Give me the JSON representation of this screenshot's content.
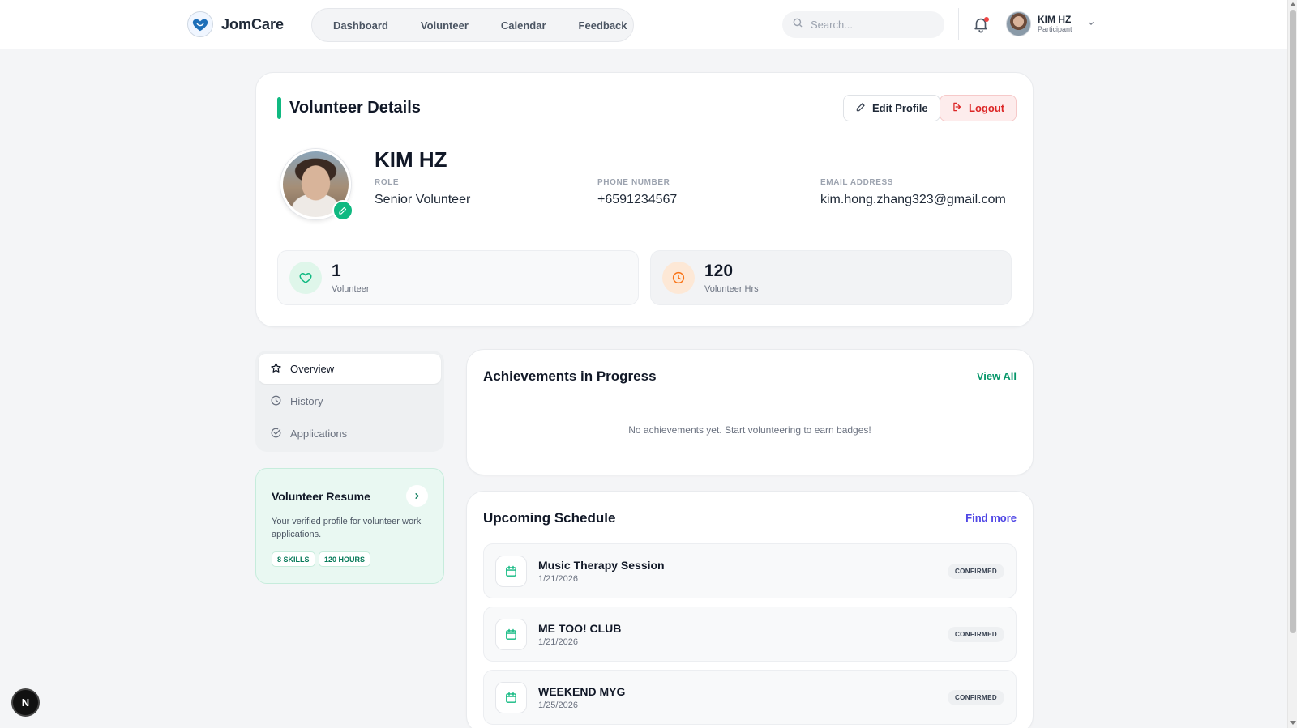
{
  "brand": {
    "name": "JomCare"
  },
  "nav": {
    "items": [
      "Dashboard",
      "Volunteer",
      "Calendar",
      "Feedback"
    ]
  },
  "search": {
    "placeholder": "Search..."
  },
  "user": {
    "name": "KIM HZ",
    "role": "Participant"
  },
  "profile": {
    "section_title": "Volunteer Details",
    "edit_label": "Edit Profile",
    "logout_label": "Logout",
    "name": "KIM HZ",
    "role_label": "ROLE",
    "role_value": "Senior Volunteer",
    "phone_label": "PHONE NUMBER",
    "phone_value": "+6591234567",
    "email_label": "EMAIL ADDRESS",
    "email_value": "kim.hong.zhang323@gmail.com"
  },
  "stats": [
    {
      "value": "1",
      "label": "Volunteer",
      "icon": "heart-icon",
      "color": "#10b981"
    },
    {
      "value": "120",
      "label": "Volunteer Hrs",
      "icon": "clock-icon",
      "color": "#f97316"
    }
  ],
  "tabs": [
    {
      "label": "Overview",
      "icon": "star-icon",
      "active": true
    },
    {
      "label": "History",
      "icon": "clock-icon",
      "active": false
    },
    {
      "label": "Applications",
      "icon": "check-circle-icon",
      "active": false
    }
  ],
  "resume": {
    "title": "Volunteer Resume",
    "description": "Your verified profile for volunteer work applications.",
    "chips": [
      "8 SKILLS",
      "120 HOURS"
    ]
  },
  "achievements": {
    "title": "Achievements in Progress",
    "link": "View All",
    "empty_text": "No achievements yet. Start volunteering to earn badges!"
  },
  "schedule": {
    "title": "Upcoming Schedule",
    "link": "Find more",
    "events": [
      {
        "title": "Music Therapy Session",
        "date": "1/21/2026",
        "status": "CONFIRMED"
      },
      {
        "title": "ME TOO! CLUB",
        "date": "1/21/2026",
        "status": "CONFIRMED"
      },
      {
        "title": "WEEKEND MYG",
        "date": "1/25/2026",
        "status": "CONFIRMED"
      }
    ]
  },
  "fab": {
    "label": "N"
  },
  "colors": {
    "accent": "#10b981",
    "danger": "#dc2626",
    "link_green": "#059669",
    "link_indigo": "#4f46e5"
  }
}
